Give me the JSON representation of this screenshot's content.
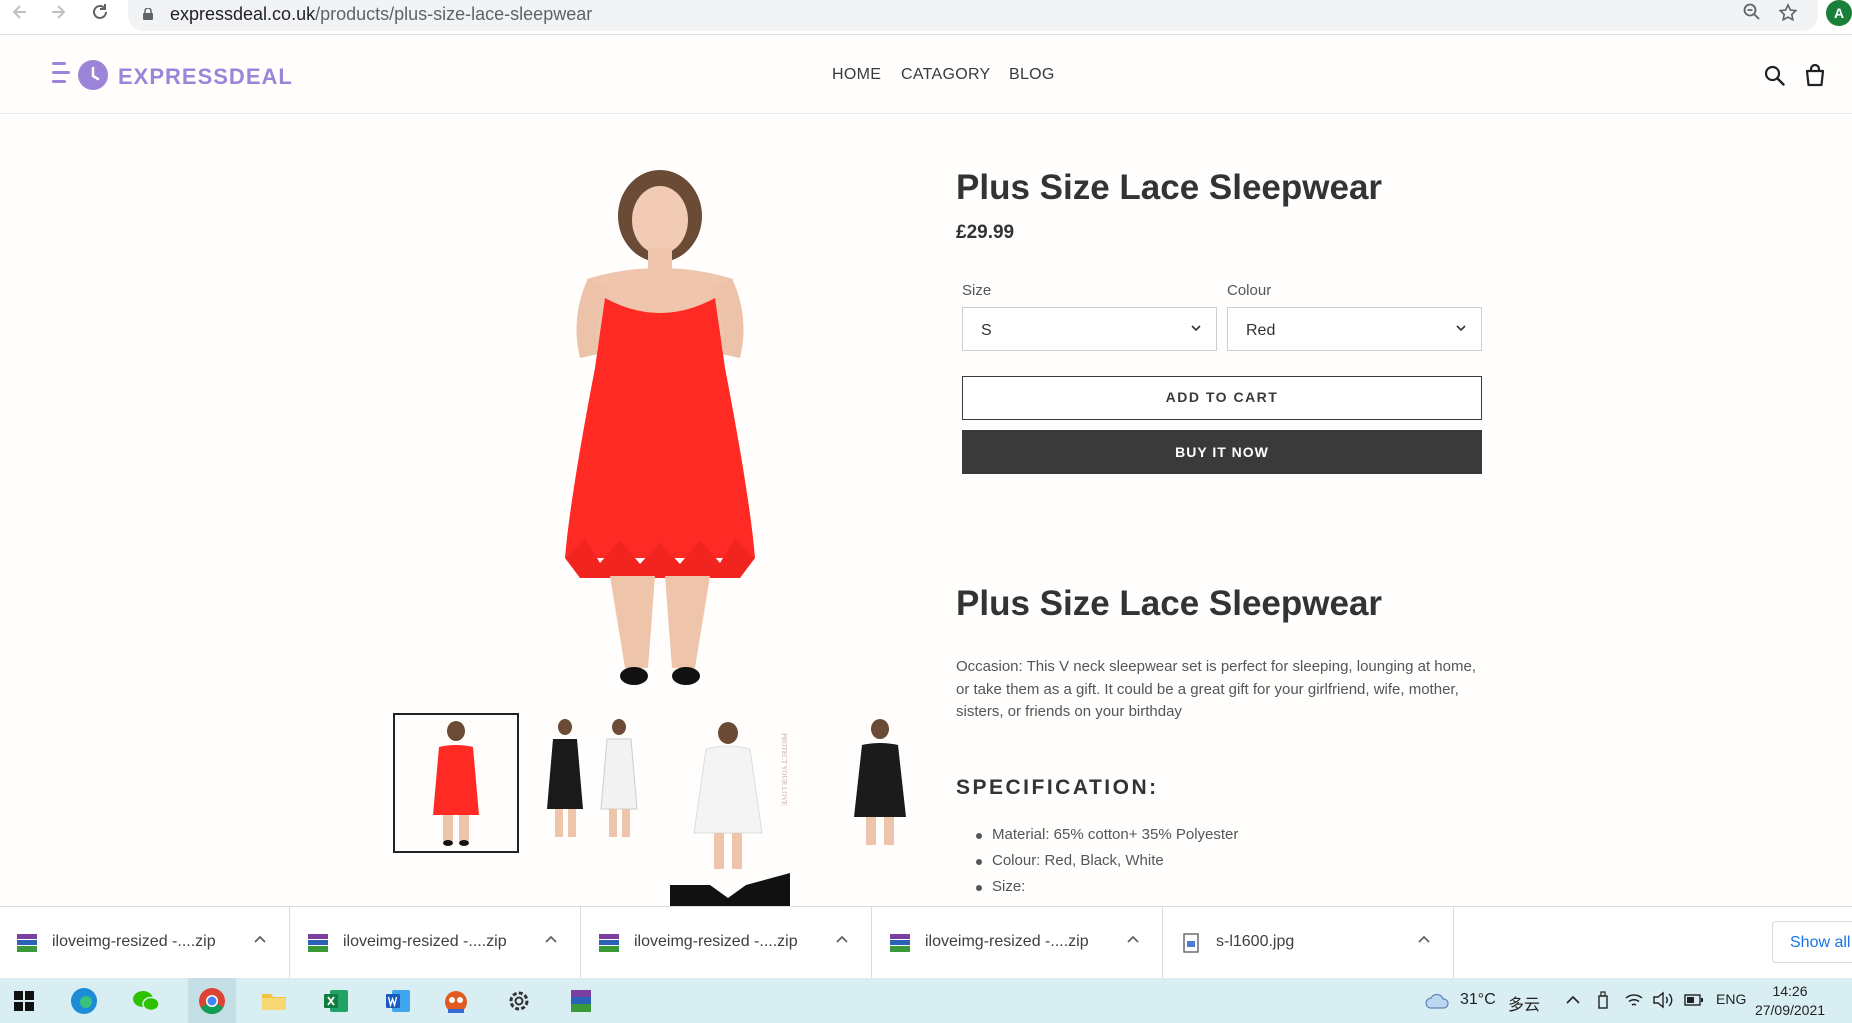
{
  "browser": {
    "url_domain": "expressdeal.co.uk",
    "url_path": "/products/plus-size-lace-sleepwear",
    "profile_initial": "A"
  },
  "site": {
    "logo_text": "EXPRESSDEAL",
    "brand_color": "#9c85d9",
    "nav": [
      "HOME",
      "CATAGORY",
      "BLOG"
    ]
  },
  "product": {
    "title": "Plus Size Lace Sleepwear",
    "price": "£29.99",
    "size_label": "Size",
    "size_value": "S",
    "colour_label": "Colour",
    "colour_value": "Red",
    "add_to_cart": "ADD TO CART",
    "buy_now": "BUY IT NOW",
    "desc_title": "Plus Size Lace Sleepwear",
    "description": "Occasion: This V neck sleepwear set is perfect for sleeping, lounging at home, or take them as a gift. It could be a great gift for your girlfriend, wife, mother, sisters, or friends on your birthday",
    "spec_heading": "SPECIFICATION:",
    "spec_items": [
      "Material: 65% cotton+ 35% Polyester",
      "Colour: Red, Black, White",
      "Size:"
    ],
    "thumb_stamp": "PROTECT YOUR LOVE"
  },
  "downloads": {
    "items": [
      "iloveimg-resized -....zip",
      "iloveimg-resized -....zip",
      "iloveimg-resized -....zip",
      "iloveimg-resized -....zip",
      "s-l1600.jpg"
    ],
    "show_all": "Show all"
  },
  "taskbar": {
    "weather_temp": "31°C",
    "weather_desc": "多云",
    "language": "ENG",
    "time": "14:26",
    "date": "27/09/2021"
  }
}
